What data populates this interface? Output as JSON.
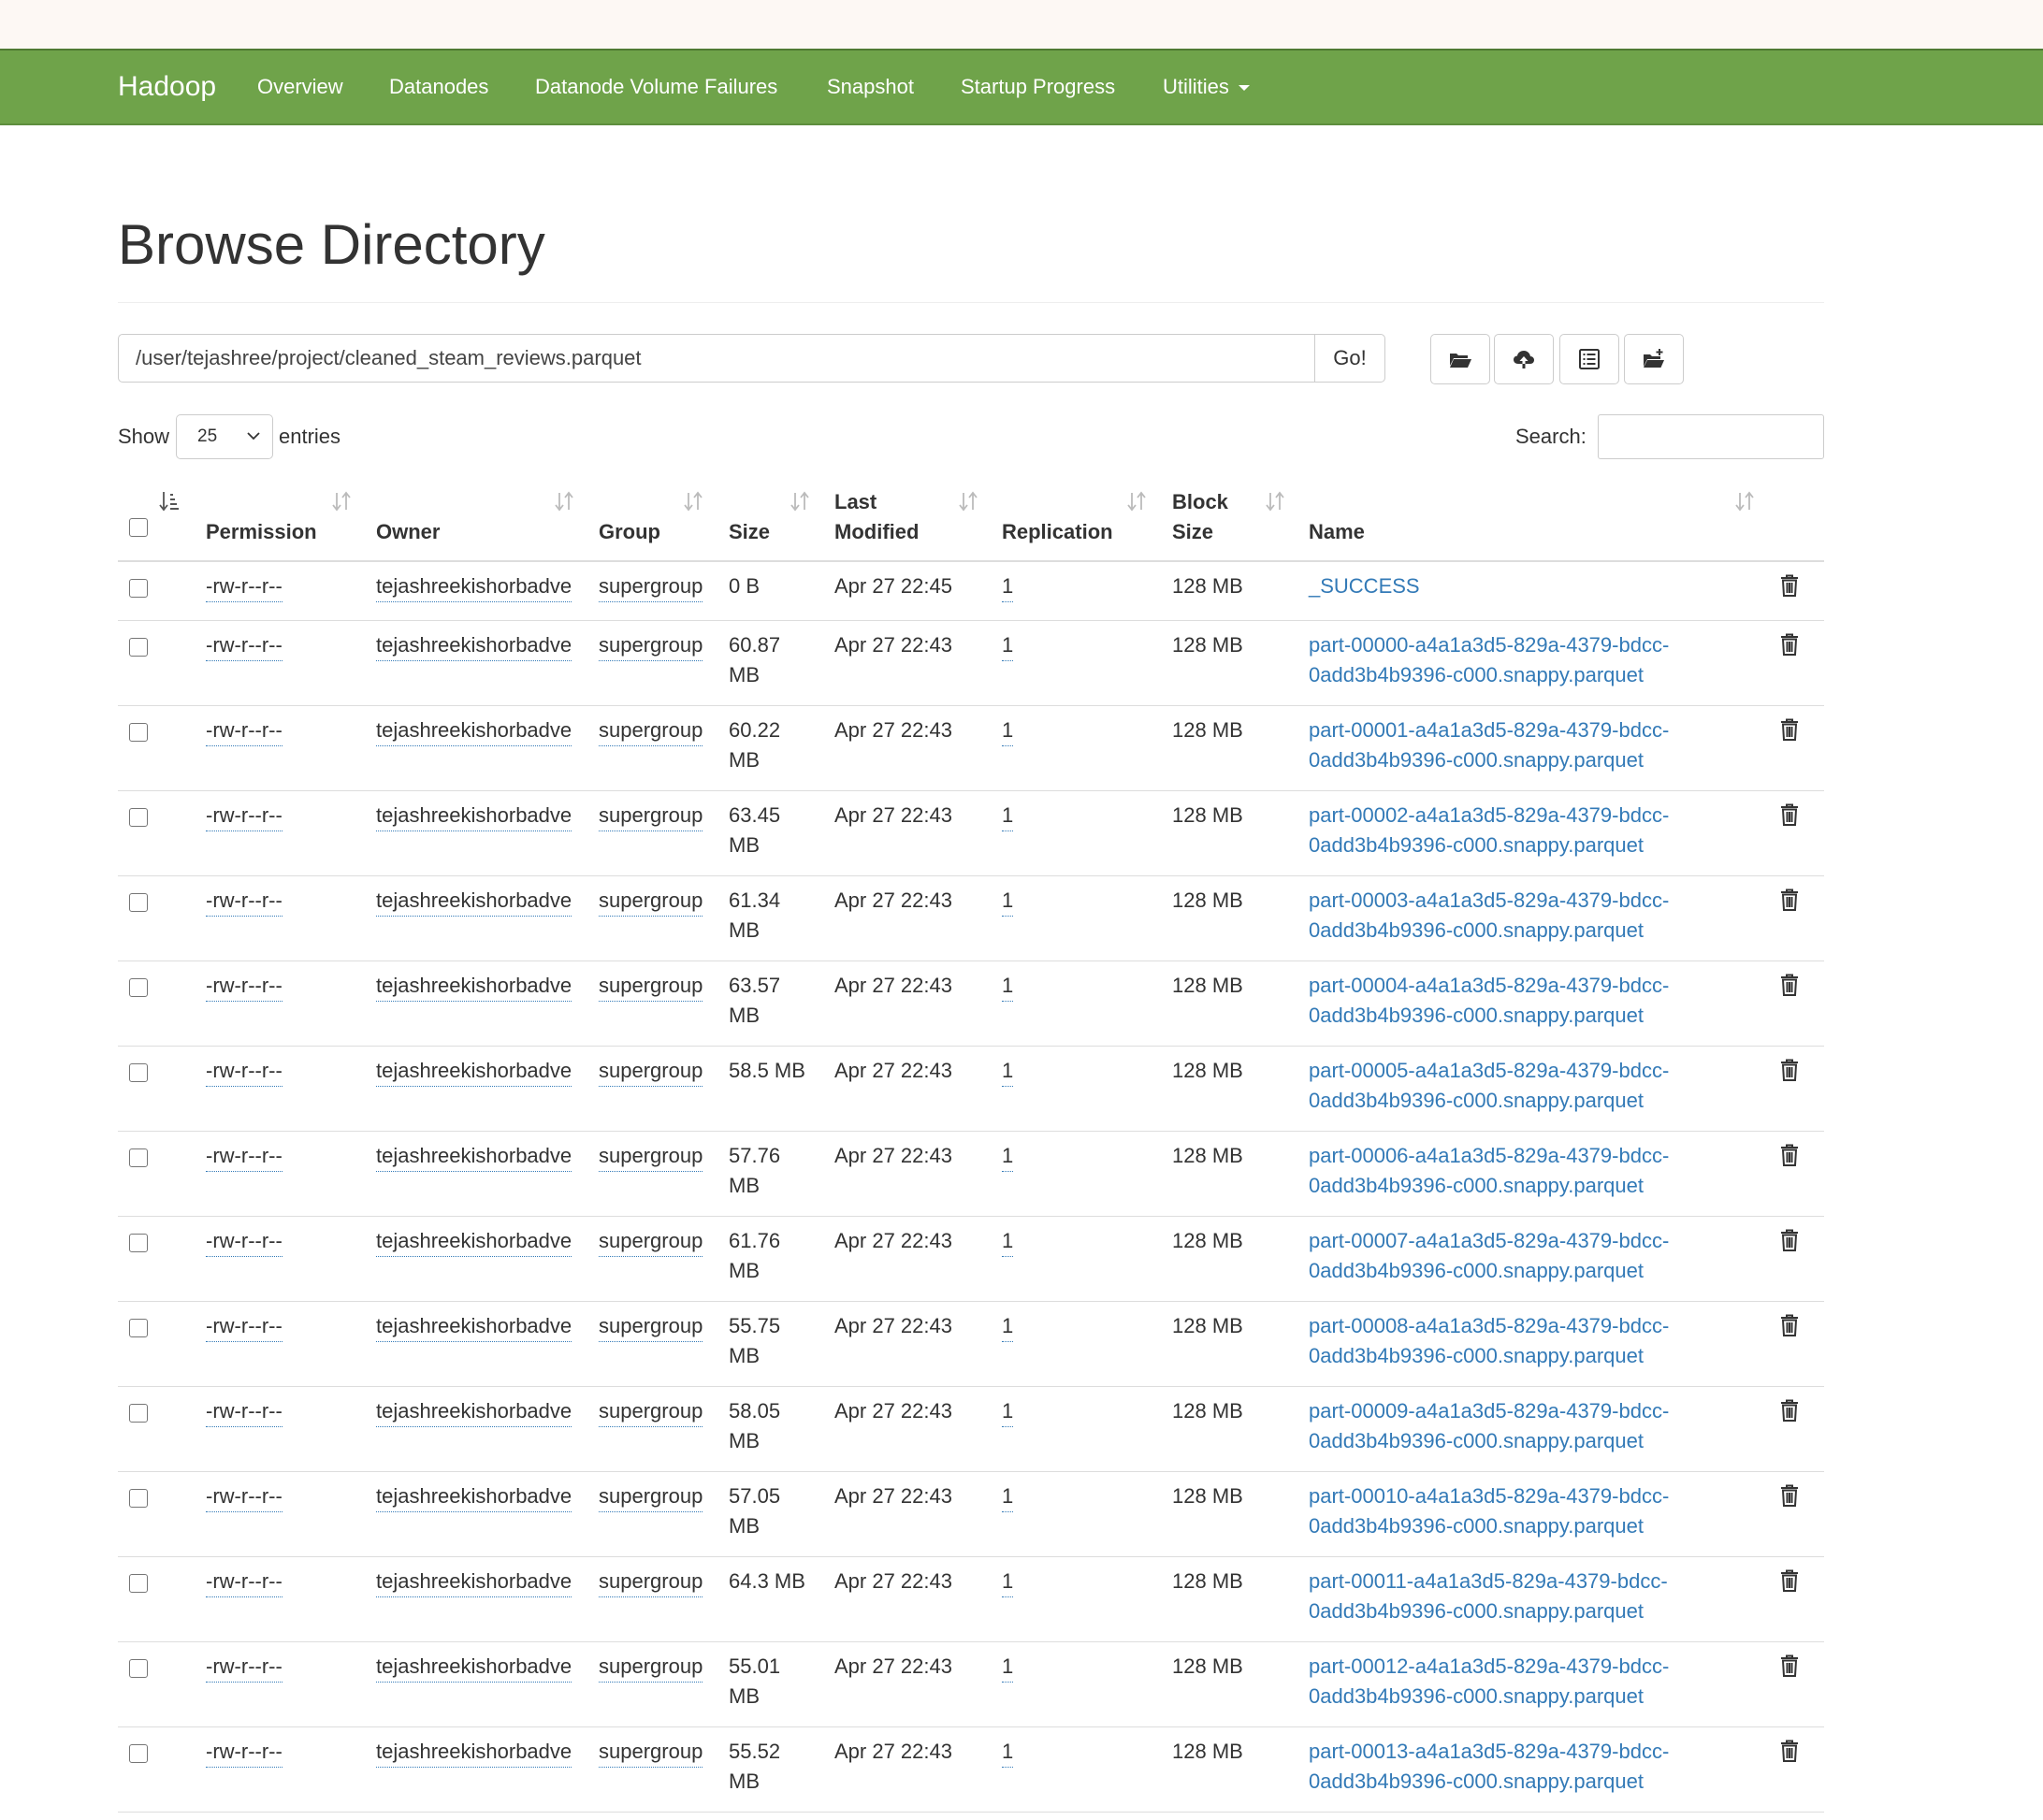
{
  "navbar": {
    "brand": "Hadoop",
    "items": [
      "Overview",
      "Datanodes",
      "Datanode Volume Failures",
      "Snapshot",
      "Startup Progress",
      "Utilities"
    ]
  },
  "page": {
    "title": "Browse Directory",
    "path": "/user/tejashree/project/cleaned_steam_reviews.parquet",
    "go_label": "Go!",
    "toolbar_icons": [
      "folder-open-icon",
      "cloud-upload-icon",
      "list-alt-icon",
      "create-folder-icon"
    ]
  },
  "controls": {
    "show_label": "Show",
    "entries_value": "25",
    "entries_label": "entries",
    "search_label": "Search:",
    "search_value": ""
  },
  "table": {
    "headers": {
      "permission": "Permission",
      "owner": "Owner",
      "group": "Group",
      "size": "Size",
      "last_modified_1": "Last",
      "last_modified_2": "Modified",
      "replication": "Replication",
      "block_size_1": "Block",
      "block_size_2": "Size",
      "name": "Name"
    },
    "rows": [
      {
        "perm": "-rw-r--r--",
        "owner": "tejashreekishorbadve",
        "group": "supergroup",
        "size1": "0 B",
        "size2": "",
        "modified": "Apr 27 22:45",
        "replication": "1",
        "block": "128 MB",
        "name1": "_SUCCESS",
        "name2": ""
      },
      {
        "perm": "-rw-r--r--",
        "owner": "tejashreekishorbadve",
        "group": "supergroup",
        "size1": "60.87",
        "size2": "MB",
        "modified": "Apr 27 22:43",
        "replication": "1",
        "block": "128 MB",
        "name1": "part-00000-a4a1a3d5-829a-4379-bdcc-",
        "name2": "0add3b4b9396-c000.snappy.parquet"
      },
      {
        "perm": "-rw-r--r--",
        "owner": "tejashreekishorbadve",
        "group": "supergroup",
        "size1": "60.22",
        "size2": "MB",
        "modified": "Apr 27 22:43",
        "replication": "1",
        "block": "128 MB",
        "name1": "part-00001-a4a1a3d5-829a-4379-bdcc-",
        "name2": "0add3b4b9396-c000.snappy.parquet"
      },
      {
        "perm": "-rw-r--r--",
        "owner": "tejashreekishorbadve",
        "group": "supergroup",
        "size1": "63.45",
        "size2": "MB",
        "modified": "Apr 27 22:43",
        "replication": "1",
        "block": "128 MB",
        "name1": "part-00002-a4a1a3d5-829a-4379-bdcc-",
        "name2": "0add3b4b9396-c000.snappy.parquet"
      },
      {
        "perm": "-rw-r--r--",
        "owner": "tejashreekishorbadve",
        "group": "supergroup",
        "size1": "61.34",
        "size2": "MB",
        "modified": "Apr 27 22:43",
        "replication": "1",
        "block": "128 MB",
        "name1": "part-00003-a4a1a3d5-829a-4379-bdcc-",
        "name2": "0add3b4b9396-c000.snappy.parquet"
      },
      {
        "perm": "-rw-r--r--",
        "owner": "tejashreekishorbadve",
        "group": "supergroup",
        "size1": "63.57",
        "size2": "MB",
        "modified": "Apr 27 22:43",
        "replication": "1",
        "block": "128 MB",
        "name1": "part-00004-a4a1a3d5-829a-4379-bdcc-",
        "name2": "0add3b4b9396-c000.snappy.parquet"
      },
      {
        "perm": "-rw-r--r--",
        "owner": "tejashreekishorbadve",
        "group": "supergroup",
        "size1": "58.5 MB",
        "size2": "",
        "modified": "Apr 27 22:43",
        "replication": "1",
        "block": "128 MB",
        "name1": "part-00005-a4a1a3d5-829a-4379-bdcc-",
        "name2": "0add3b4b9396-c000.snappy.parquet"
      },
      {
        "perm": "-rw-r--r--",
        "owner": "tejashreekishorbadve",
        "group": "supergroup",
        "size1": "57.76",
        "size2": "MB",
        "modified": "Apr 27 22:43",
        "replication": "1",
        "block": "128 MB",
        "name1": "part-00006-a4a1a3d5-829a-4379-bdcc-",
        "name2": "0add3b4b9396-c000.snappy.parquet"
      },
      {
        "perm": "-rw-r--r--",
        "owner": "tejashreekishorbadve",
        "group": "supergroup",
        "size1": "61.76",
        "size2": "MB",
        "modified": "Apr 27 22:43",
        "replication": "1",
        "block": "128 MB",
        "name1": "part-00007-a4a1a3d5-829a-4379-bdcc-",
        "name2": "0add3b4b9396-c000.snappy.parquet"
      },
      {
        "perm": "-rw-r--r--",
        "owner": "tejashreekishorbadve",
        "group": "supergroup",
        "size1": "55.75",
        "size2": "MB",
        "modified": "Apr 27 22:43",
        "replication": "1",
        "block": "128 MB",
        "name1": "part-00008-a4a1a3d5-829a-4379-bdcc-",
        "name2": "0add3b4b9396-c000.snappy.parquet"
      },
      {
        "perm": "-rw-r--r--",
        "owner": "tejashreekishorbadve",
        "group": "supergroup",
        "size1": "58.05",
        "size2": "MB",
        "modified": "Apr 27 22:43",
        "replication": "1",
        "block": "128 MB",
        "name1": "part-00009-a4a1a3d5-829a-4379-bdcc-",
        "name2": "0add3b4b9396-c000.snappy.parquet"
      },
      {
        "perm": "-rw-r--r--",
        "owner": "tejashreekishorbadve",
        "group": "supergroup",
        "size1": "57.05",
        "size2": "MB",
        "modified": "Apr 27 22:43",
        "replication": "1",
        "block": "128 MB",
        "name1": "part-00010-a4a1a3d5-829a-4379-bdcc-",
        "name2": "0add3b4b9396-c000.snappy.parquet"
      },
      {
        "perm": "-rw-r--r--",
        "owner": "tejashreekishorbadve",
        "group": "supergroup",
        "size1": "64.3 MB",
        "size2": "",
        "modified": "Apr 27 22:43",
        "replication": "1",
        "block": "128 MB",
        "name1": "part-00011-a4a1a3d5-829a-4379-bdcc-",
        "name2": "0add3b4b9396-c000.snappy.parquet"
      },
      {
        "perm": "-rw-r--r--",
        "owner": "tejashreekishorbadve",
        "group": "supergroup",
        "size1": "55.01",
        "size2": "MB",
        "modified": "Apr 27 22:43",
        "replication": "1",
        "block": "128 MB",
        "name1": "part-00012-a4a1a3d5-829a-4379-bdcc-",
        "name2": "0add3b4b9396-c000.snappy.parquet"
      },
      {
        "perm": "-rw-r--r--",
        "owner": "tejashreekishorbadve",
        "group": "supergroup",
        "size1": "55.52",
        "size2": "MB",
        "modified": "Apr 27 22:43",
        "replication": "1",
        "block": "128 MB",
        "name1": "part-00013-a4a1a3d5-829a-4379-bdcc-",
        "name2": "0add3b4b9396-c000.snappy.parquet"
      }
    ]
  },
  "colors": {
    "navbar": "#6fa34a",
    "link": "#337ab7",
    "text": "#333333",
    "border": "#dddddd"
  }
}
